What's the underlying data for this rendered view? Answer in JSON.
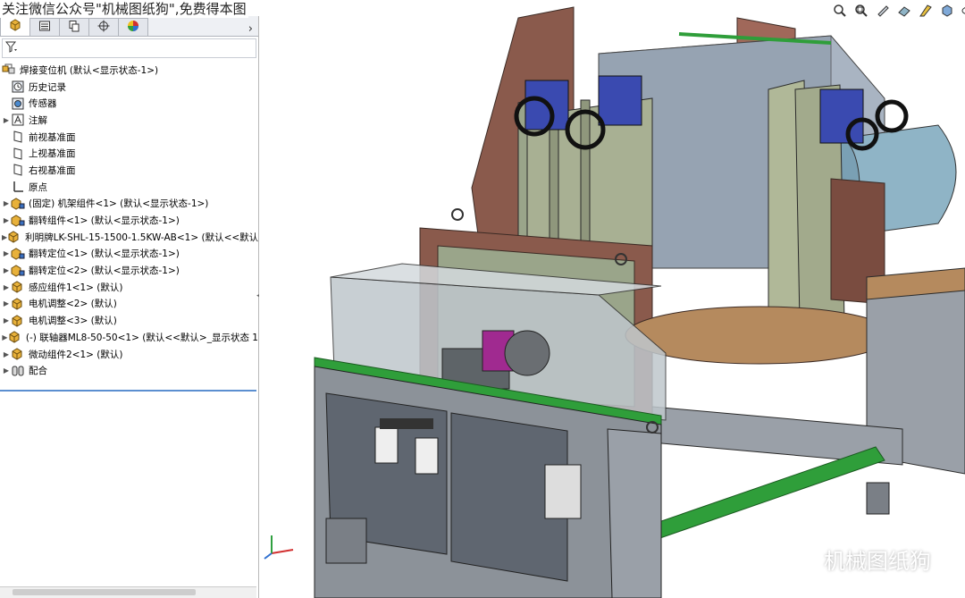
{
  "watermark": "关注微信公众号\"机械图纸狗\",免费得本图",
  "brand_text": "机械图纸狗",
  "feature_tree": {
    "root": "焊接变位机 (默认<显示状态-1>)",
    "items": [
      {
        "label": "历史记录",
        "icon": "history-icon",
        "expandable": false
      },
      {
        "label": "传感器",
        "icon": "sensor-icon",
        "expandable": false
      },
      {
        "label": "注解",
        "icon": "annotation-icon",
        "expandable": true
      },
      {
        "label": "前视基准面",
        "icon": "plane-icon",
        "expandable": false
      },
      {
        "label": "上视基准面",
        "icon": "plane-icon",
        "expandable": false
      },
      {
        "label": "右视基准面",
        "icon": "plane-icon",
        "expandable": false
      },
      {
        "label": "原点",
        "icon": "origin-icon",
        "expandable": false
      },
      {
        "label": "(固定) 机架组件<1> (默认<显示状态-1>)",
        "icon": "assembly-icon",
        "expandable": true
      },
      {
        "label": "翻转组件<1> (默认<显示状态-1>)",
        "icon": "assembly-icon",
        "expandable": true
      },
      {
        "label": "利明牌LK-SHL-15-1500-1.5KW-AB<1> (默认<<默认",
        "icon": "part-icon",
        "expandable": true
      },
      {
        "label": "翻转定位<1> (默认<显示状态-1>)",
        "icon": "assembly-icon",
        "expandable": true
      },
      {
        "label": "翻转定位<2> (默认<显示状态-1>)",
        "icon": "assembly-icon",
        "expandable": true
      },
      {
        "label": "感应组件1<1> (默认)",
        "icon": "part-icon",
        "expandable": true
      },
      {
        "label": "电机调整<2> (默认)",
        "icon": "part-icon",
        "expandable": true
      },
      {
        "label": "电机调整<3> (默认)",
        "icon": "part-icon",
        "expandable": true
      },
      {
        "label": "(-) 联轴器ML8-50-50<1> (默认<<默认>_显示状态 1",
        "icon": "part-icon",
        "expandable": true
      },
      {
        "label": "微动组件2<1> (默认)",
        "icon": "part-icon",
        "expandable": true
      },
      {
        "label": "配合",
        "icon": "mates-icon",
        "expandable": true
      }
    ]
  },
  "colors": {
    "frame": "#7a7f86",
    "panel_glass": "#bfc7cc",
    "plate_brown": "#8a5a4c",
    "plate_green": "#9aa58a",
    "accent_green": "#2f9e3a",
    "blue_plate": "#3a4ab0",
    "tan_turntable": "#b58a5e",
    "selection_line": "#5b8fd0"
  }
}
